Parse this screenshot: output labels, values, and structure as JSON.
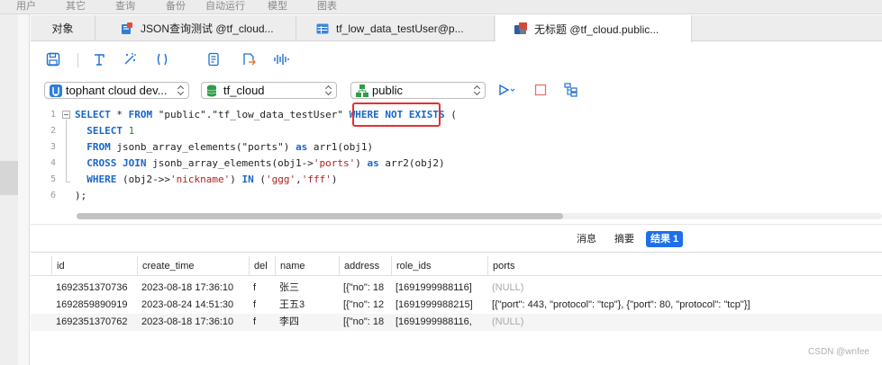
{
  "menu": [
    "用户",
    "其它",
    "查询",
    "备份",
    "自动运行",
    "模型",
    "图表"
  ],
  "tabs": [
    {
      "label": "对象",
      "active": false
    },
    {
      "label": "JSON查询测试 @tf_cloud...",
      "active": false
    },
    {
      "label": "tf_low_data_testUser@p...",
      "active": false
    },
    {
      "label": "无标题 @tf_cloud.public...",
      "active": true
    }
  ],
  "toolbar": {
    "icons": [
      "save-icon",
      "format-icon",
      "beautify-icon",
      "parentheses-icon",
      "snippet-icon",
      "export-icon",
      "explain-icon"
    ]
  },
  "selectors": {
    "connection": "tophant cloud dev...",
    "database": "tf_cloud",
    "schema": "public"
  },
  "actions": {
    "run": "run-icon",
    "stop": "stop-icon",
    "plan": "plan-icon"
  },
  "editor": {
    "line_numbers": [
      "1",
      "2",
      "3",
      "4",
      "5",
      "6"
    ],
    "lines": [
      [
        {
          "t": "SELECT",
          "c": "kw"
        },
        {
          "t": " * ",
          "c": ""
        },
        {
          "t": "FROM",
          "c": "kw"
        },
        {
          "t": " \"public\".\"tf_low_data_testUser\" ",
          "c": ""
        },
        {
          "t": "WHERE",
          "c": "kw"
        },
        {
          "t": " ",
          "c": ""
        },
        {
          "t": "NOT",
          "c": "kw"
        },
        {
          "t": " ",
          "c": ""
        },
        {
          "t": "EXISTS",
          "c": "kw"
        },
        {
          "t": " (",
          "c": ""
        }
      ],
      [
        {
          "t": "  SELECT",
          "c": "kw"
        },
        {
          "t": " ",
          "c": ""
        },
        {
          "t": "1",
          "c": "num"
        }
      ],
      [
        {
          "t": "  FROM",
          "c": "kw"
        },
        {
          "t": " jsonb_array_elements(\"ports\") ",
          "c": ""
        },
        {
          "t": "as",
          "c": "kw"
        },
        {
          "t": " arr1(obj1)",
          "c": ""
        }
      ],
      [
        {
          "t": "  CROSS JOIN",
          "c": "kw"
        },
        {
          "t": " jsonb_array_elements(obj1->",
          "c": ""
        },
        {
          "t": "'ports'",
          "c": "str"
        },
        {
          "t": ") ",
          "c": ""
        },
        {
          "t": "as",
          "c": "kw"
        },
        {
          "t": " arr2(obj2)",
          "c": ""
        }
      ],
      [
        {
          "t": "  WHERE",
          "c": "kw"
        },
        {
          "t": " (obj2->>",
          "c": ""
        },
        {
          "t": "'nickname'",
          "c": "str"
        },
        {
          "t": ") ",
          "c": ""
        },
        {
          "t": "IN",
          "c": "kw"
        },
        {
          "t": " (",
          "c": ""
        },
        {
          "t": "'ggg'",
          "c": "str"
        },
        {
          "t": ",",
          "c": ""
        },
        {
          "t": "'fff'",
          "c": "str"
        },
        {
          "t": ")",
          "c": ""
        }
      ],
      [
        {
          "t": ");",
          "c": ""
        }
      ]
    ]
  },
  "result_tabs": [
    {
      "label": "消息",
      "active": false
    },
    {
      "label": "摘要",
      "active": false
    },
    {
      "label": "结果 1",
      "active": true
    }
  ],
  "grid": {
    "columns": [
      "id",
      "create_time",
      "del",
      "name",
      "address",
      "role_ids",
      "ports"
    ],
    "rows": [
      [
        "1692351370736",
        "2023-08-18 17:36:10",
        "f",
        "张三",
        "[{\"no\": 18",
        "[1691999988116]",
        "(NULL)"
      ],
      [
        "1692859890919",
        "2023-08-24 14:51:30",
        "f",
        "王五3",
        "[{\"no\": 12",
        "[1691999988215]",
        "[{\"port\": 443, \"protocol\": \"tcp\"}, {\"port\": 80, \"protocol\": \"tcp\"}]"
      ],
      [
        "1692351370762",
        "2023-08-18 17:36:10",
        "f",
        "李四",
        "[{\"no\": 18",
        "[1691999988116,",
        "(NULL)"
      ]
    ]
  },
  "watermark": "CSDN @wnfee",
  "colors": {
    "accent": "#1f6feb",
    "keyword": "#1a66c9",
    "string": "#b32020",
    "highlight": "#e53030"
  }
}
